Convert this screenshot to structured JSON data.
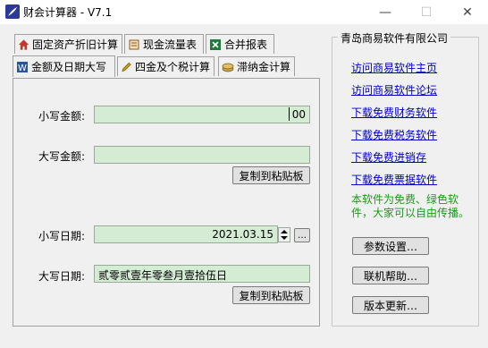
{
  "window": {
    "title": "财会计算器 - V7.1"
  },
  "tabs_row1": [
    {
      "label": "固定资产折旧计算",
      "icon": "home-icon"
    },
    {
      "label": "现金流量表",
      "icon": "scroll-icon"
    },
    {
      "label": "合并报表",
      "icon": "excel-icon"
    }
  ],
  "tabs_row2": [
    {
      "label": "金额及日期大写",
      "icon": "word-icon",
      "active": true
    },
    {
      "label": "四金及个税计算",
      "icon": "pencil-icon"
    },
    {
      "label": "滞纳金计算",
      "icon": "coins-icon"
    }
  ],
  "form": {
    "lower_amount_label": "小写金额:",
    "lower_amount_decimal": "00",
    "upper_amount_label": "大写金额:",
    "upper_amount_value": "",
    "copy_button_1": "复制到粘贴板",
    "lower_date_label": "小写日期:",
    "lower_date_value": "2021.03.15",
    "date_picker_button": "…",
    "upper_date_label": "大写日期:",
    "upper_date_value": "贰零贰壹年零叁月壹拾伍日",
    "copy_button_2": "复制到粘贴板"
  },
  "sidebar": {
    "title": "青岛商易软件有限公司",
    "links": [
      "访问商易软件主页",
      "访问商易软件论坛",
      "下载免费财务软件",
      "下载免费税务软件",
      "下载免费进销存",
      "下载免费票据软件"
    ],
    "note": "本软件为免费、绿色软件，大家可以自由传播。",
    "buttons": [
      "参数设置…",
      "联机帮助…",
      "版本更新…"
    ]
  },
  "colors": {
    "field_bg": "#d4ecd4",
    "link": "#0000cc",
    "note": "#1a9a1a"
  }
}
